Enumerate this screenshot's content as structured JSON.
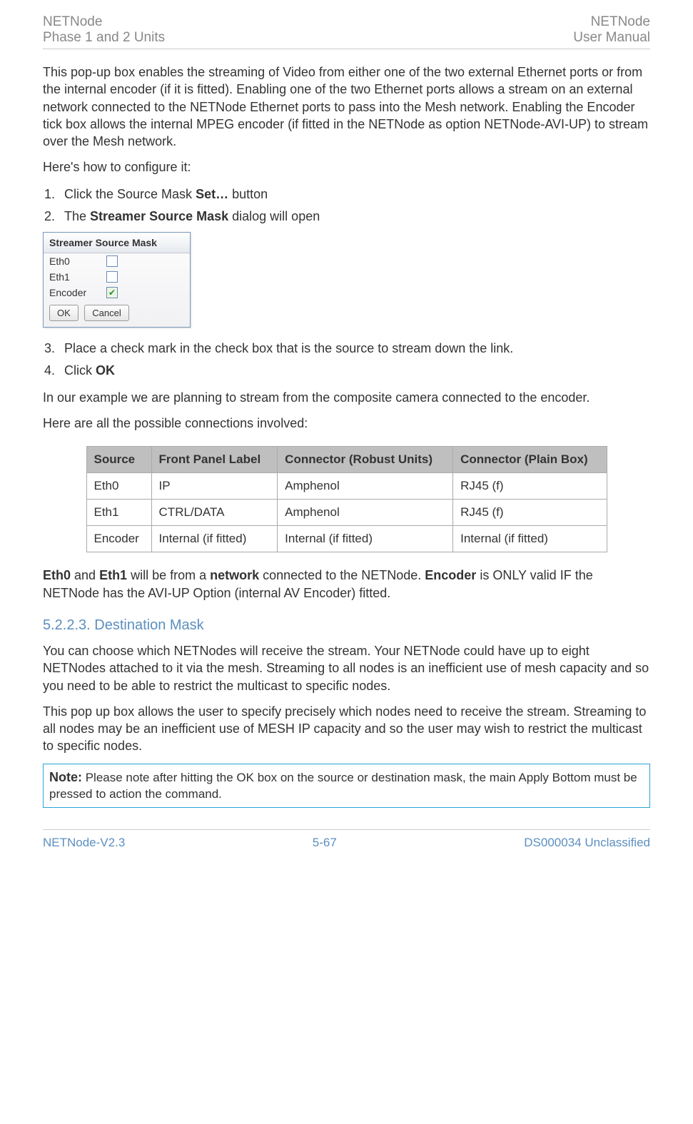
{
  "header": {
    "left_line1": "NETNode",
    "left_line2": "Phase 1 and 2 Units",
    "right_line1": "NETNode",
    "right_line2": "User Manual"
  },
  "intro_para": "This pop-up box enables the streaming of Video from either one of the two external Ethernet ports or from the internal encoder (if it is fitted). Enabling one of the two Ethernet ports allows a stream on an external network connected to the NETNode Ethernet ports to pass into the Mesh network. Enabling the Encoder tick box allows the internal MPEG encoder (if fitted in the NETNode as option NETNode-AVI-UP) to stream over the Mesh network.",
  "configure_line": "Here's how to configure it:",
  "steps12": {
    "s1_pre": "Click the Source Mask ",
    "s1_bold": "Set…",
    "s1_post": " button",
    "s2_pre": "The ",
    "s2_bold": "Streamer Source Mask",
    "s2_post": " dialog will open"
  },
  "dialog": {
    "title": "Streamer Source Mask",
    "rows": [
      {
        "label": "Eth0",
        "checked": false
      },
      {
        "label": "Eth1",
        "checked": false
      },
      {
        "label": "Encoder",
        "checked": true
      }
    ],
    "ok": "OK",
    "cancel": "Cancel"
  },
  "steps34": {
    "s3": "Place a check mark in the check box that is the source to stream down the link.",
    "s4_pre": "Click ",
    "s4_bold": "OK"
  },
  "example_para": "In our example we are planning to stream from the composite camera connected to the encoder.",
  "connections_intro": "Here are all the possible connections involved:",
  "table": {
    "headers": [
      "Source",
      "Front Panel Label",
      "Connector (Robust Units)",
      "Connector (Plain Box)"
    ],
    "rows": [
      [
        "Eth0",
        "IP",
        "Amphenol",
        "RJ45 (f)"
      ],
      [
        "Eth1",
        "CTRL/DATA",
        "Amphenol",
        "RJ45 (f)"
      ],
      [
        "Encoder",
        "Internal (if fitted)",
        "Internal (if fitted)",
        "Internal (if fitted)"
      ]
    ]
  },
  "eth_para": {
    "b1": "Eth0",
    "t1": " and ",
    "b2": "Eth1",
    "t2": " will be from a ",
    "b3": "network",
    "t3": " connected to the NETNode. ",
    "b4": "Encoder",
    "t4": " is ONLY valid IF the NETNode has the AVI-UP Option (internal AV Encoder) fitted."
  },
  "section": {
    "num_title": "5.2.2.3. Destination Mask"
  },
  "dest_p1": "You can choose which NETNodes will receive the stream. Your NETNode could have up to eight NETNodes attached to it via the mesh. Streaming to all nodes is an inefficient use of mesh capacity and so you need to be able to restrict the multicast to specific nodes.",
  "dest_p2": "This pop up box allows the user to specify precisely which nodes need to receive the stream. Streaming to all nodes may be an inefficient use of MESH IP capacity and so the user may wish to restrict the multicast to specific nodes.",
  "note": {
    "label": "Note:",
    "text": " Please note after hitting the OK box on the source or destination mask, the main Apply Bottom must be pressed to action the command."
  },
  "footer": {
    "left": "NETNode-V2.3",
    "center": "5-67",
    "right": "DS000034 Unclassified"
  }
}
